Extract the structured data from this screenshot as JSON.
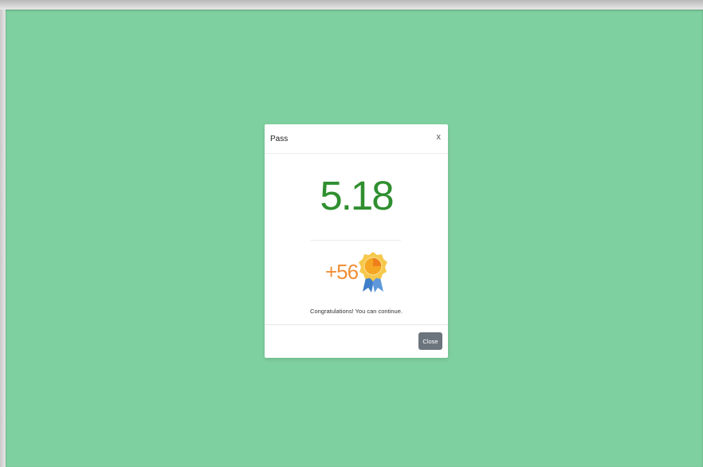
{
  "modal": {
    "title": "Pass",
    "close_symbol": "x",
    "score": "5.18",
    "reward": "+56",
    "reward_icon": "award-medal-icon",
    "message": "Congratulations! You can continue.",
    "close_button": "Close"
  },
  "colors": {
    "background": "#7fd0a0",
    "score": "#2f8f2f",
    "reward": "#f08f36",
    "button": "#6c757d"
  }
}
